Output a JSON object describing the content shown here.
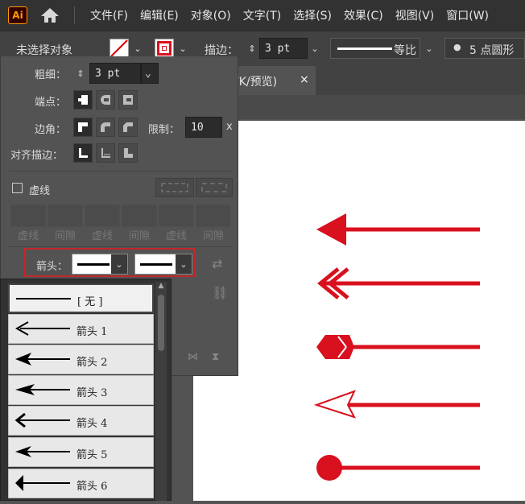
{
  "app": {
    "logo": "Ai"
  },
  "menu": [
    "文件(F)",
    "编辑(E)",
    "对象(O)",
    "文字(T)",
    "选择(S)",
    "效果(C)",
    "视图(V)",
    "窗口(W)"
  ],
  "control": {
    "selection_status": "未选择对象",
    "stroke_label": "描边：",
    "stroke_weight": "3 pt",
    "profile_label": "等比",
    "brush_label": "5 点圆形"
  },
  "document": {
    "tab_label": "/K/预览)",
    "close_symbol": "×"
  },
  "stroke_panel": {
    "weight_label": "粗细：",
    "weight_value": "3 pt",
    "cap_label": "端点：",
    "corner_label": "边角：",
    "limit_label": "限制：",
    "limit_value": "10",
    "limit_unit": "x",
    "align_label": "对齐描边：",
    "dashed_label": "虚线",
    "dash_labels": [
      "虚线",
      "间隙",
      "虚线",
      "间隙",
      "虚线",
      "间隙"
    ],
    "arrowhead_label": "箭头："
  },
  "arrow_list": {
    "items": [
      "[ 无 ]",
      "箭头 1",
      "箭头 2",
      "箭头 3",
      "箭头 4",
      "箭头 5",
      "箭头 6"
    ]
  },
  "colors": {
    "accent_red": "#d9101e",
    "highlight_border": "#c1272d"
  }
}
